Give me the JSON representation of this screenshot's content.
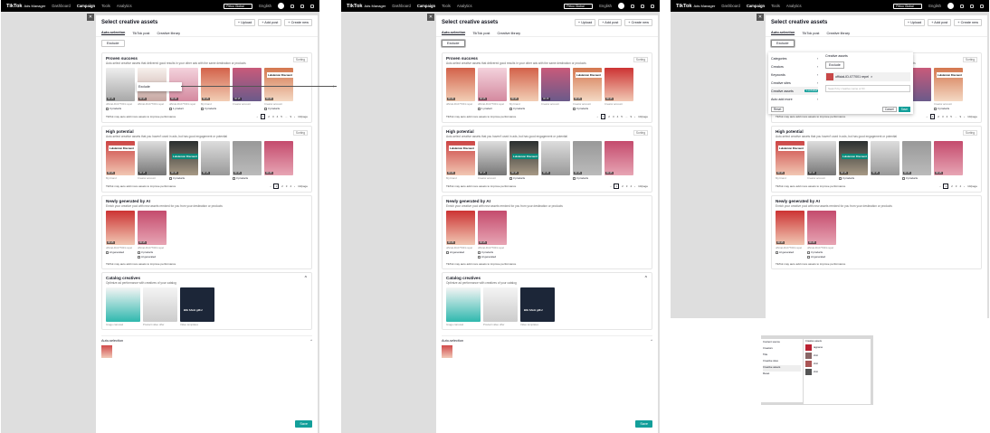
{
  "topbar": {
    "logo": "TikTok",
    "product": "Ads Manager",
    "nav": [
      "Dashboard",
      "Campaign",
      "Tools",
      "Analytics"
    ],
    "active_nav": "Campaign",
    "account": "Petco Global",
    "language": "English"
  },
  "modal": {
    "title": "Select creative assets",
    "header_buttons": [
      "+ Upload",
      "+ Add post",
      "+ Create new"
    ],
    "tabs": [
      "Auto-selection",
      "TikTok post",
      "Creative library"
    ],
    "exclude_label": "Exclude",
    "sort_label": "Sorting",
    "footnote": "TikTok may auto add more assets to improve performance",
    "proven": {
      "title": "Proven success",
      "desc": "Auto-select creative assets that delivered good results in your other ads with the same destination or products",
      "pages": [
        "1",
        "2",
        "3",
        "4",
        "5",
        "...",
        "9"
      ]
    },
    "potential": {
      "title": "High potential",
      "desc": "Auto-select creative assets that you haven't used in ads, but has good engagement or potential",
      "pages": [
        "1",
        "2",
        "3",
        "4"
      ]
    },
    "ai": {
      "title": "Newly generated by AI",
      "desc": "Enrich your creative pool with new assets remixed for you from your destination or products"
    },
    "catalog": {
      "title": "Catalog creatives",
      "desc": "Optimize ad performance with creatives of your catalog",
      "items": [
        {
          "caption": "Image carousel"
        },
        {
          "caption": "Product video offer"
        },
        {
          "caption": "Video templates",
          "label": "BIG SALE gifts!"
        }
      ]
    },
    "auto_selection_label": "Auto-selection",
    "save_label": "Save",
    "products_label": "3 products",
    "product_label": "1 product",
    "ai_generated": "AI generated",
    "caption_account": "official-ID-077001 repel",
    "caption_brand": "My brand",
    "caption_creator": "Creator account",
    "overlay_text": "Lululemon Discount",
    "page_size": "10/page"
  },
  "context_menu": {
    "item": "Exclude"
  },
  "dropdown": {
    "categories": [
      "Categories",
      "Creators",
      "Keywords",
      "Creative sites",
      "Creative assets",
      "Auto add more"
    ],
    "selected_badge": "1 excluded",
    "right_title": "Creative assets",
    "exclude_btn": "Exclude",
    "chip_text": "official-ID-077001 repel",
    "search_placeholder": "Search by creative name or ID",
    "reset": "Reset",
    "cancel": "Cancel",
    "save": "Save"
  },
  "mini_panel": {
    "left": [
      "Content source",
      "Creators",
      "Title",
      "Creative sites",
      "Creative assets"
    ],
    "right_title": "Creative assets",
    "rows": [
      "tagname",
      "shot",
      "shot",
      "shot"
    ],
    "footer": "Reset"
  }
}
